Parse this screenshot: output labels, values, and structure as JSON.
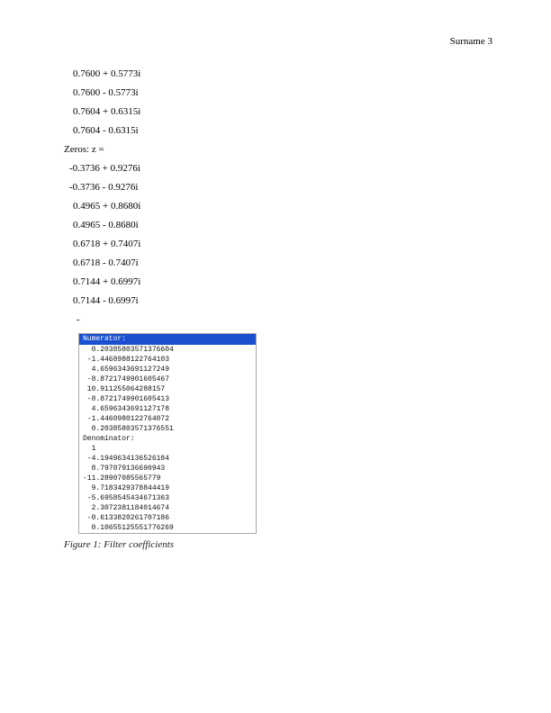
{
  "header": {
    "surname": "Surname",
    "page": "3"
  },
  "poles": [
    "0.7600 + 0.5773i",
    "0.7600 - 0.5773i",
    "0.7604 + 0.6315i",
    "0.7604 - 0.6315i"
  ],
  "zeros_label": "Zeros: z =",
  "zeros": [
    "-0.3736 + 0.9276i",
    "-0.3736 - 0.9276i",
    "0.4965 + 0.8680i",
    "0.4965 - 0.8680i",
    "0.6718 + 0.7407i",
    "0.6718 - 0.7407i",
    "0.7144 + 0.6997i",
    "0.7144 - 0.6997i"
  ],
  "dash": "-",
  "coef": {
    "num_label": "Numerator:",
    "numerator": [
      "  0.20385803571376604",
      " -1.4468988122764103",
      "  4.6596343691127249",
      " -8.8721749901605467",
      " 10.911255064288157",
      " -8.8721749901605413",
      "  4.6596343691127178",
      " -1.4460980122764072",
      "  0.20385803571376551"
    ],
    "den_label": "Denominator:",
    "denominator": [
      "  1",
      " -4.1949634136526184",
      "  8.797079136690943",
      "-11.28907085565779",
      "  9.7183429378844419",
      " -5.6958545434671363",
      "  2.3072381184014674",
      " -0.6133820261707186",
      "  0.10655125551776269"
    ]
  },
  "caption": "Figure 1: Filter coefficients"
}
